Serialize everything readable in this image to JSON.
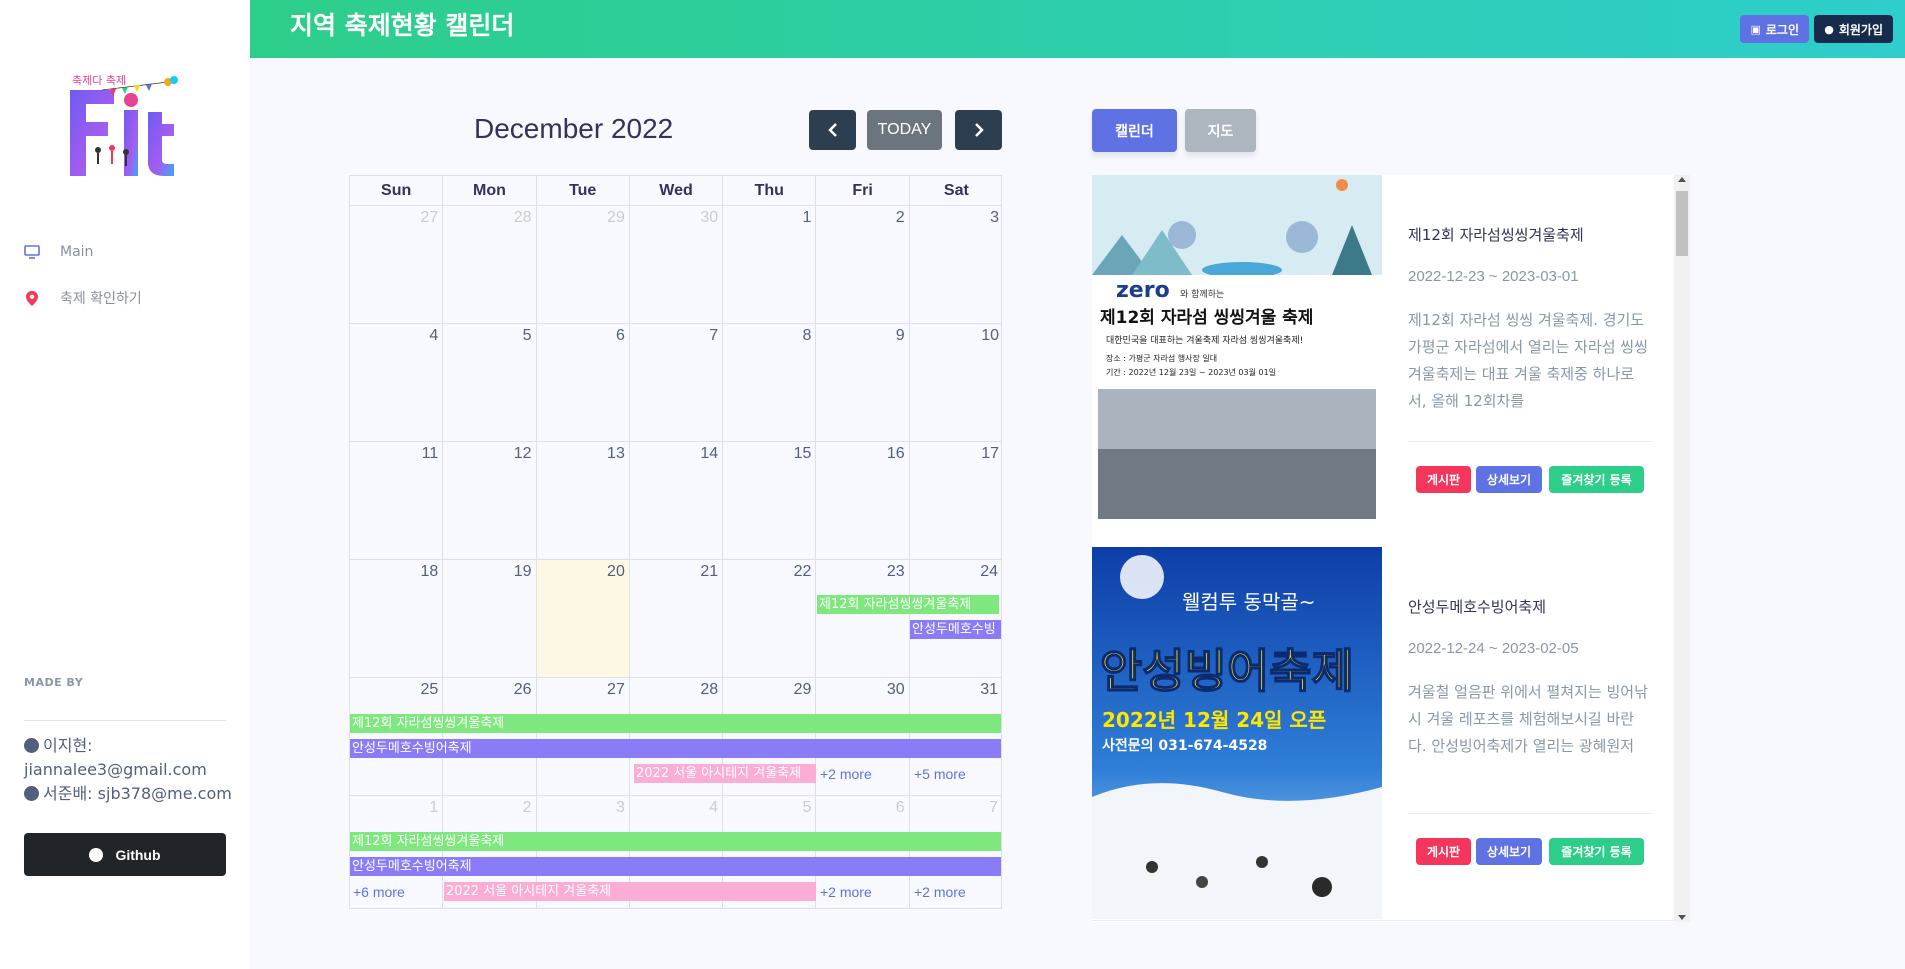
{
  "header": {
    "title": "지역 축제현황 캘린더",
    "login_label": "로그인",
    "join_label": "회원가입"
  },
  "sidebar": {
    "logo_text": "축제다 축제",
    "logo_word": "Fit",
    "nav": [
      {
        "label": "Main",
        "icon": "monitor-icon"
      },
      {
        "label": "축제 확인하기",
        "icon": "map-pin-icon"
      }
    ],
    "made_by": "MADE BY",
    "authors": [
      {
        "name": "이지현:",
        "email": "jiannalee3@gmail.com"
      },
      {
        "name": "서준배:",
        "email": "sjb378@me.com"
      }
    ],
    "github_label": "Github"
  },
  "calendar": {
    "title": "December 2022",
    "today_label": "TODAY",
    "prev_icon": "chevron-left-icon",
    "next_icon": "chevron-right-icon",
    "days": [
      "Sun",
      "Mon",
      "Tue",
      "Wed",
      "Thu",
      "Fri",
      "Sat"
    ],
    "weeks": [
      [
        "27",
        "28",
        "29",
        "30",
        "1",
        "2",
        "3"
      ],
      [
        "4",
        "5",
        "6",
        "7",
        "8",
        "9",
        "10"
      ],
      [
        "11",
        "12",
        "13",
        "14",
        "15",
        "16",
        "17"
      ],
      [
        "18",
        "19",
        "20",
        "21",
        "22",
        "23",
        "24"
      ],
      [
        "25",
        "26",
        "27",
        "28",
        "29",
        "30",
        "31"
      ],
      [
        "1",
        "2",
        "3",
        "4",
        "5",
        "6",
        "7"
      ]
    ],
    "events": {
      "jarasum": "제12회 자라섬씽씽겨울축제",
      "anseong": "안성두메호수빙어축제",
      "anseong_short": "안성두메호수빙",
      "seoul": "2022 서울 아시테지 겨울축제"
    },
    "more": {
      "w5_fri": "+2 more",
      "w5_sat": "+5 more",
      "w6_sun": "+6 more",
      "w6_fri": "+2 more",
      "w6_sat": "+2 more"
    }
  },
  "tabs": {
    "calendar_label": "캘린더",
    "map_label": "지도"
  },
  "festivals": [
    {
      "title": "제12회 자라섬씽씽겨울축제",
      "date": "2022-12-23 ~ 2023-03-01",
      "desc": "제12회 자라섬 씽씽 겨울축제. 경기도 가평군 자라섬에서 열리는 자라섬 씽씽겨울축제는 대표 겨울 축제중 하나로서, 올해 12회차를",
      "poster_brand": "zero",
      "poster_sub": "와 함께하는",
      "poster_title": "제12회 자라섬 씽씽겨울 축제",
      "poster_line1": "대한민국을 대표하는 겨울축제 자라섬 씽씽겨울축제!",
      "poster_line2": "장소 : 가평군 자라섬 행사장 일대",
      "poster_line3": "기간 : 2022년 12월 23일 ~ 2023년 03월 01일",
      "btn_board": "게시판",
      "btn_detail": "상세보기",
      "btn_fav": "즐겨찾기 등록"
    },
    {
      "title": "안성두메호수빙어축제",
      "date": "2022-12-24 ~ 2023-02-05",
      "desc": "겨울철 얼음판 위에서 펼쳐지는 빙어낚시 겨울 레포츠를 체험해보시길 바란다. 안성빙어축제가 열리는 광혜원저",
      "poster_welcome": "웰컴투 동막골~",
      "poster_title": "안성빙어축제",
      "poster_open": "2022년 12월 24일 오픈",
      "poster_phone": "사전문의 031-674-4528",
      "btn_board": "게시판",
      "btn_detail": "상세보기",
      "btn_fav": "즐겨찾기 등록"
    }
  ],
  "colors": {
    "header_from": "#2dce89",
    "header_to": "#2dcecc",
    "primary": "#5e72e4",
    "event_green": "#7ee87e",
    "event_purple": "#8a7cf7",
    "event_pink": "#fbadd6",
    "today_bg": "#fcf8e3"
  }
}
